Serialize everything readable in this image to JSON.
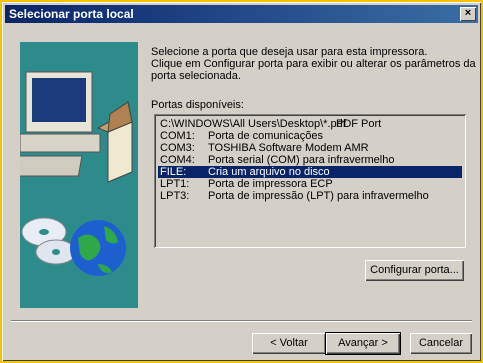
{
  "window": {
    "title": "Selecionar porta local",
    "close_glyph": "×"
  },
  "description": {
    "line1": "Selecione a porta que deseja usar para esta impressora.",
    "line2": "Clique em Configurar porta para exibir ou alterar os parâmetros da",
    "line3": "porta selecionada."
  },
  "ports_label": "Portas disponíveis:",
  "ports": [
    {
      "port": "C:\\WINDOWS\\All Users\\Desktop\\*.pdf",
      "desc": "PDF Port",
      "selected": false
    },
    {
      "port": "COM1:",
      "desc": "Porta de comunicações",
      "selected": false
    },
    {
      "port": "COM3:",
      "desc": "TOSHIBA Software Modem AMR",
      "selected": false
    },
    {
      "port": "COM4:",
      "desc": "Porta serial (COM) para infravermelho",
      "selected": false
    },
    {
      "port": "FILE:",
      "desc": "Cria um arquivo no disco",
      "selected": true
    },
    {
      "port": "LPT1:",
      "desc": "Porta de impressora ECP",
      "selected": false
    },
    {
      "port": "LPT3:",
      "desc": "Porta de impressão (LPT) para infravermelho",
      "selected": false
    }
  ],
  "buttons": {
    "configure": "Configurar porta...",
    "back": "< Voltar",
    "next": "Avançar >",
    "cancel": "Cancelar"
  },
  "icons": [
    "computer-icon",
    "cd-disc-icon",
    "globe-icon",
    "box-icon"
  ],
  "colors": {
    "selection": "#0a246a",
    "titlebar": "#0a246a",
    "dialog": "#d4d0c8",
    "background": "#f5c400"
  }
}
